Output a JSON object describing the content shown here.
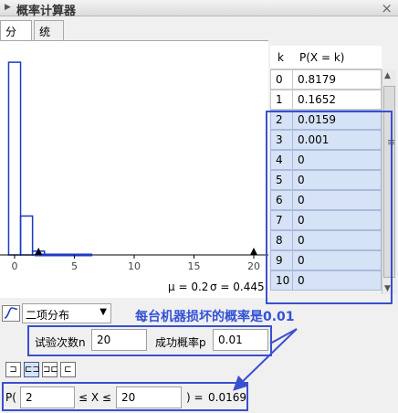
{
  "window": {
    "title": "概率计算器",
    "close_glyph": "×"
  },
  "tabs": [
    {
      "label": "分布"
    },
    {
      "label": "统计"
    }
  ],
  "plot": {
    "mean_text": "μ = 0.2",
    "sigma_text": "σ = 0.445",
    "tick_labels": [
      "0",
      "5",
      "10",
      "15",
      "20"
    ]
  },
  "chart_data": {
    "type": "bar",
    "x": [
      0,
      1,
      2,
      3
    ],
    "values": [
      0.8179,
      0.1652,
      0.0159,
      0.001
    ],
    "highlight_range": [
      2,
      20
    ],
    "xlim": [
      -1,
      21
    ],
    "ylim": [
      0,
      0.9
    ],
    "xticks": [
      0,
      5,
      10,
      15,
      20
    ],
    "colors": {
      "bar": "#1e3bbf",
      "highlight": "#1e3bbf",
      "marker": "#000000"
    }
  },
  "table": {
    "header_k": "k",
    "header_p": "P(X = k)",
    "rows": [
      {
        "k": "0",
        "p": "0.8179",
        "selected": false
      },
      {
        "k": "1",
        "p": "0.1652",
        "selected": false
      },
      {
        "k": "2",
        "p": "0.0159",
        "selected": true
      },
      {
        "k": "3",
        "p": "0.001",
        "selected": true
      },
      {
        "k": "4",
        "p": "0",
        "selected": true
      },
      {
        "k": "5",
        "p": "0",
        "selected": true
      },
      {
        "k": "6",
        "p": "0",
        "selected": true
      },
      {
        "k": "7",
        "p": "0",
        "selected": true
      },
      {
        "k": "8",
        "p": "0",
        "selected": true
      },
      {
        "k": "9",
        "p": "0",
        "selected": true
      },
      {
        "k": "10",
        "p": "0",
        "selected": true
      }
    ],
    "scroll_grip": "≡"
  },
  "annotation": {
    "text": "每台机器损坏的概率是0.01"
  },
  "distribution": {
    "selected": "二项分布",
    "caret": "▼"
  },
  "params": {
    "n_label": "试验次数n",
    "n_value": "20",
    "p_label": "成功概率p",
    "p_value": "0.01"
  },
  "toolbar": {
    "buttons": [
      {
        "glyph": "⊐"
      },
      {
        "glyph": "⊏⊐"
      },
      {
        "glyph": "⊐⊏"
      },
      {
        "glyph": "⊏"
      }
    ]
  },
  "probability": {
    "prefix": "P(",
    "lower": "2",
    "middle": "≤ X ≤",
    "upper": "20",
    "suffix": ") =",
    "result": "0.0169"
  },
  "colors": {
    "annotation": "#3a4fd0",
    "selection": "#d6e2f5",
    "bar": "#1e3bbf"
  }
}
